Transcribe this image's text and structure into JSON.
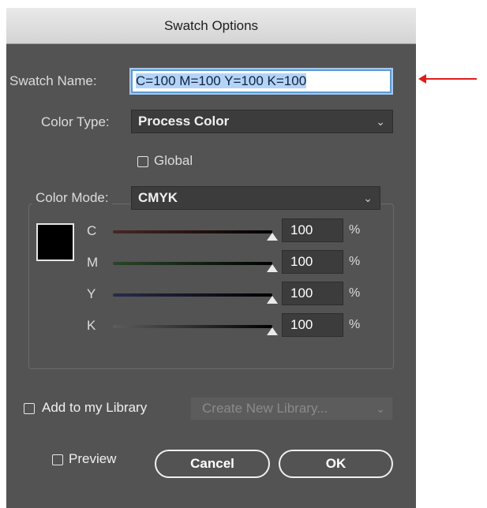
{
  "dialog": {
    "title": "Swatch Options"
  },
  "swatch_name": {
    "label": "Swatch Name:",
    "value": "C=100 M=100 Y=100 K=100"
  },
  "color_type": {
    "label": "Color Type:",
    "value": "Process Color"
  },
  "global": {
    "label": "Global",
    "checked": false
  },
  "color_mode": {
    "label": "Color Mode:",
    "value": "CMYK"
  },
  "preview_color": "#000000",
  "channels": [
    {
      "label": "C",
      "value": "100",
      "unit": "%"
    },
    {
      "label": "M",
      "value": "100",
      "unit": "%"
    },
    {
      "label": "Y",
      "value": "100",
      "unit": "%"
    },
    {
      "label": "K",
      "value": "100",
      "unit": "%"
    }
  ],
  "library": {
    "label": "Add to my Library",
    "checked": false,
    "dropdown_value": "Create New Library..."
  },
  "preview": {
    "label": "Preview",
    "checked": false
  },
  "buttons": {
    "cancel": "Cancel",
    "ok": "OK"
  },
  "annotation": {
    "arrow_color": "#e01b1b",
    "arrow_icon": "left-arrow-icon"
  },
  "icons": {
    "dropdown": "chevron-down-icon",
    "slider": "triangle-up-icon"
  }
}
